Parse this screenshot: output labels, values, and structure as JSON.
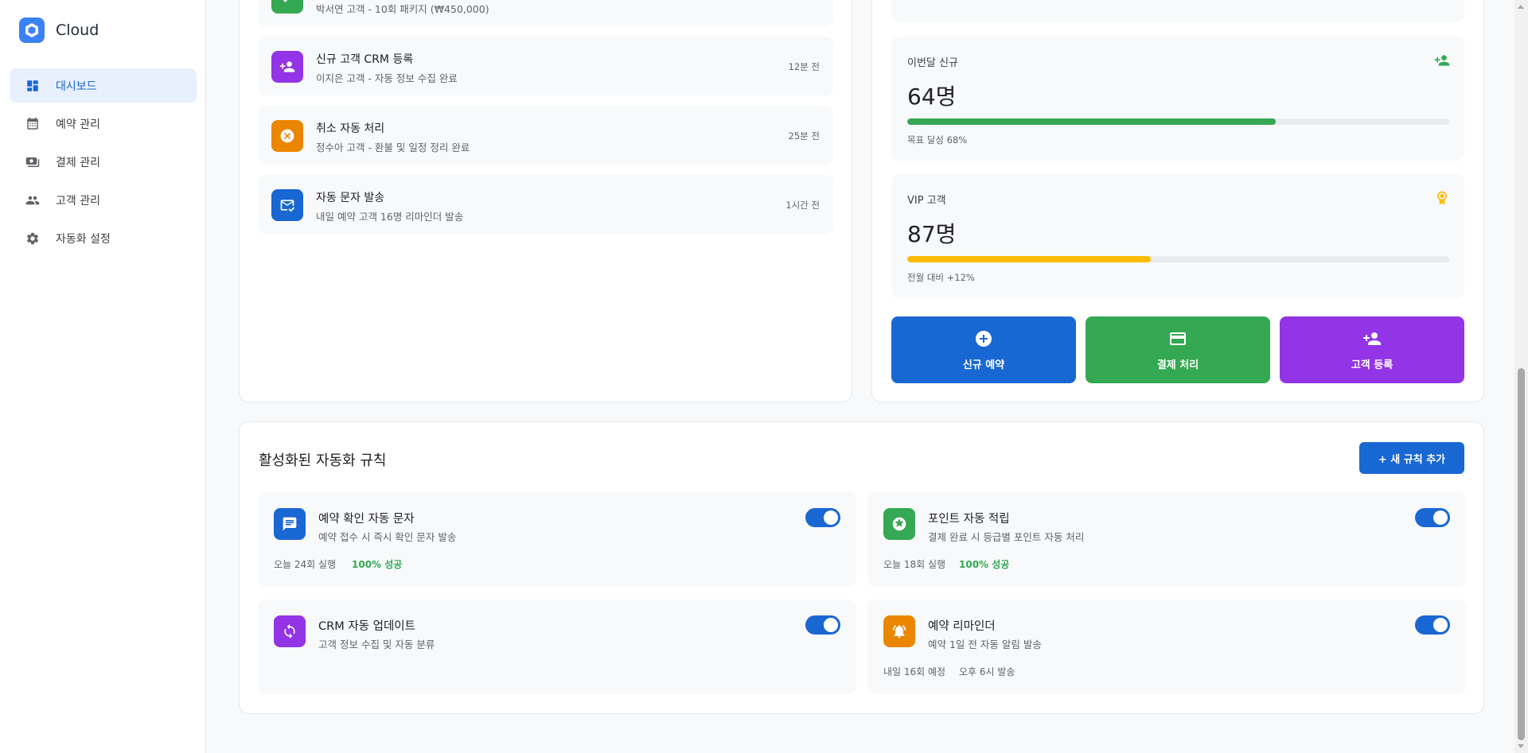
{
  "brand": {
    "name": "Cloud"
  },
  "sidebar": {
    "items": [
      {
        "label": "대시보드",
        "icon": "dashboard-icon",
        "active": true
      },
      {
        "label": "예약 관리",
        "icon": "calendar-icon",
        "active": false
      },
      {
        "label": "결제 관리",
        "icon": "payment-icon",
        "active": false
      },
      {
        "label": "고객 관리",
        "icon": "people-icon",
        "active": false
      },
      {
        "label": "자동화 설정",
        "icon": "gear-icon",
        "active": false
      }
    ]
  },
  "activity": {
    "items": [
      {
        "title": "",
        "desc": "박서연 고객 - 10회 패키지 (₩450,000)",
        "time": "",
        "icon": "payment-check-icon",
        "color": "#34a853"
      },
      {
        "title": "신규 고객 CRM 등록",
        "desc": "이지은 고객 - 자동 정보 수집 완료",
        "time": "12분 전",
        "icon": "person-add-icon",
        "color": "#9334e6"
      },
      {
        "title": "취소 자동 처리",
        "desc": "정수아 고객 - 환불 및 일정 정리 완료",
        "time": "25분 전",
        "icon": "cancel-icon",
        "color": "#ea8600"
      },
      {
        "title": "자동 문자 발송",
        "desc": "내일 예약 고객 16명 리마인더 발송",
        "time": "1시간 전",
        "icon": "message-check-icon",
        "color": "#1967d2"
      }
    ]
  },
  "stats": {
    "top_partial": {
      "sub": ""
    },
    "new_this_month": {
      "label": "이번달 신규",
      "value": "64명",
      "progress": 0.68,
      "sub": "목표 달성 68%",
      "icon": "person-add-icon",
      "color": "#34a853"
    },
    "vip": {
      "label": "VIP 고객",
      "value": "87명",
      "progress": 0.45,
      "sub": "전월 대비 +12%",
      "icon": "award-icon",
      "color": "#fbbc04"
    }
  },
  "actions": {
    "new_booking": {
      "label": "신규 예약",
      "icon": "plus-circle-icon",
      "color": "#1967d2"
    },
    "payment": {
      "label": "결제 처리",
      "icon": "card-icon",
      "color": "#34a853"
    },
    "customer_register": {
      "label": "고객 등록",
      "icon": "person-add-icon",
      "color": "#9334e6"
    }
  },
  "rules": {
    "title": "활성화된 자동화 규칙",
    "add_label": "+ 새 규칙 추가",
    "items": [
      {
        "title": "예약 확인 자동 문자",
        "desc": "예약 접수 시 즉시 확인 문자 발송",
        "meta": "오늘 24회 실행",
        "status": "100% 성공",
        "icon": "chat-icon",
        "color": "#1967d2",
        "enabled": true
      },
      {
        "title": "포인트 자동 적립",
        "desc": "결제 완료 시 등급별 포인트 자동 처리",
        "meta": "오늘 18회 실행",
        "status": "100% 성공",
        "icon": "star-badge-icon",
        "color": "#34a853",
        "enabled": true
      },
      {
        "title": "CRM 자동 업데이트",
        "desc": "고객 정보 수집 및 자동 분류",
        "meta": "",
        "status": "",
        "icon": "sync-icon",
        "color": "#9334e6",
        "enabled": true
      },
      {
        "title": "예약 리마인더",
        "desc": "예약 1일 전 자동 알림 발송",
        "meta": "내일 16회 예정",
        "status": "오후 6시 발송",
        "icon": "alarm-icon",
        "color": "#ea8600",
        "enabled": true
      }
    ]
  }
}
